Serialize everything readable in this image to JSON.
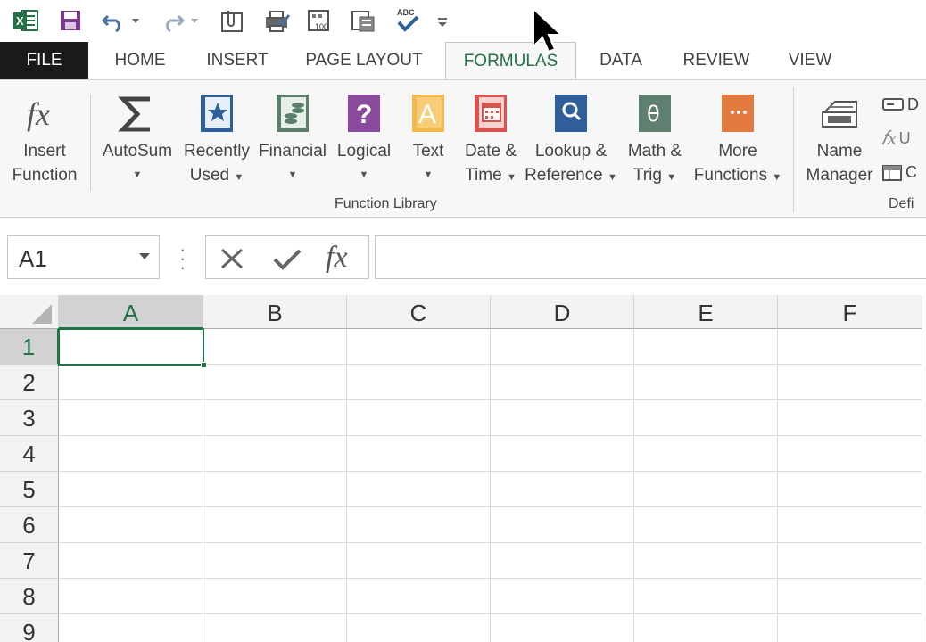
{
  "quick_access": {
    "icons": [
      "excel-logo-icon",
      "save-icon",
      "undo-icon",
      "redo-icon",
      "attach-icon",
      "print-check-icon",
      "number-format-icon",
      "clipboard-icon",
      "spelling-icon",
      "customize-icon"
    ],
    "spelling_abc": "ABC",
    "number_format_text": "100"
  },
  "tabs": {
    "file": "FILE",
    "home": "HOME",
    "insert": "INSERT",
    "page_layout": "PAGE LAYOUT",
    "formulas": "FORMULAS",
    "data": "DATA",
    "review": "REVIEW",
    "view": "VIEW",
    "active": "FORMULAS"
  },
  "ribbon": {
    "insert_function": {
      "line1": "Insert",
      "line2": "Function"
    },
    "autosum": {
      "line1": "AutoSum"
    },
    "recently_used": {
      "line1": "Recently",
      "line2": "Used"
    },
    "financial": {
      "line1": "Financial"
    },
    "logical": {
      "line1": "Logical"
    },
    "text": {
      "line1": "Text"
    },
    "date_time": {
      "line1": "Date &",
      "line2": "Time"
    },
    "lookup": {
      "line1": "Lookup &",
      "line2": "Reference"
    },
    "math": {
      "line1": "Math &",
      "line2": "Trig"
    },
    "more": {
      "line1": "More",
      "line2": "Functions"
    },
    "name_manager": {
      "line1": "Name",
      "line2": "Manager"
    },
    "function_library_label": "Function Library",
    "defined_names_label": "Defi",
    "define_name_letter": "D",
    "use_in_formula_letter": "U",
    "create_letter": "C"
  },
  "colors": {
    "accent": "#217346",
    "file_tab_bg": "#1a1a1a",
    "financial": "#5b7f6a",
    "logical": "#8a4a9d",
    "text": "#f2b84b",
    "date_time": "#d9534f",
    "lookup": "#2e5f9a",
    "math": "#5f7f6f",
    "more": "#e27a3f",
    "recently_used": "#2e5f9a"
  },
  "formula_bar": {
    "name_box": "A1",
    "formula_value": "",
    "fx_label": "fx"
  },
  "grid": {
    "columns": [
      "A",
      "B",
      "C",
      "D",
      "E",
      "F"
    ],
    "rows": [
      "1",
      "2",
      "3",
      "4",
      "5",
      "6",
      "7",
      "8",
      "9"
    ],
    "active_cell": "A1"
  }
}
